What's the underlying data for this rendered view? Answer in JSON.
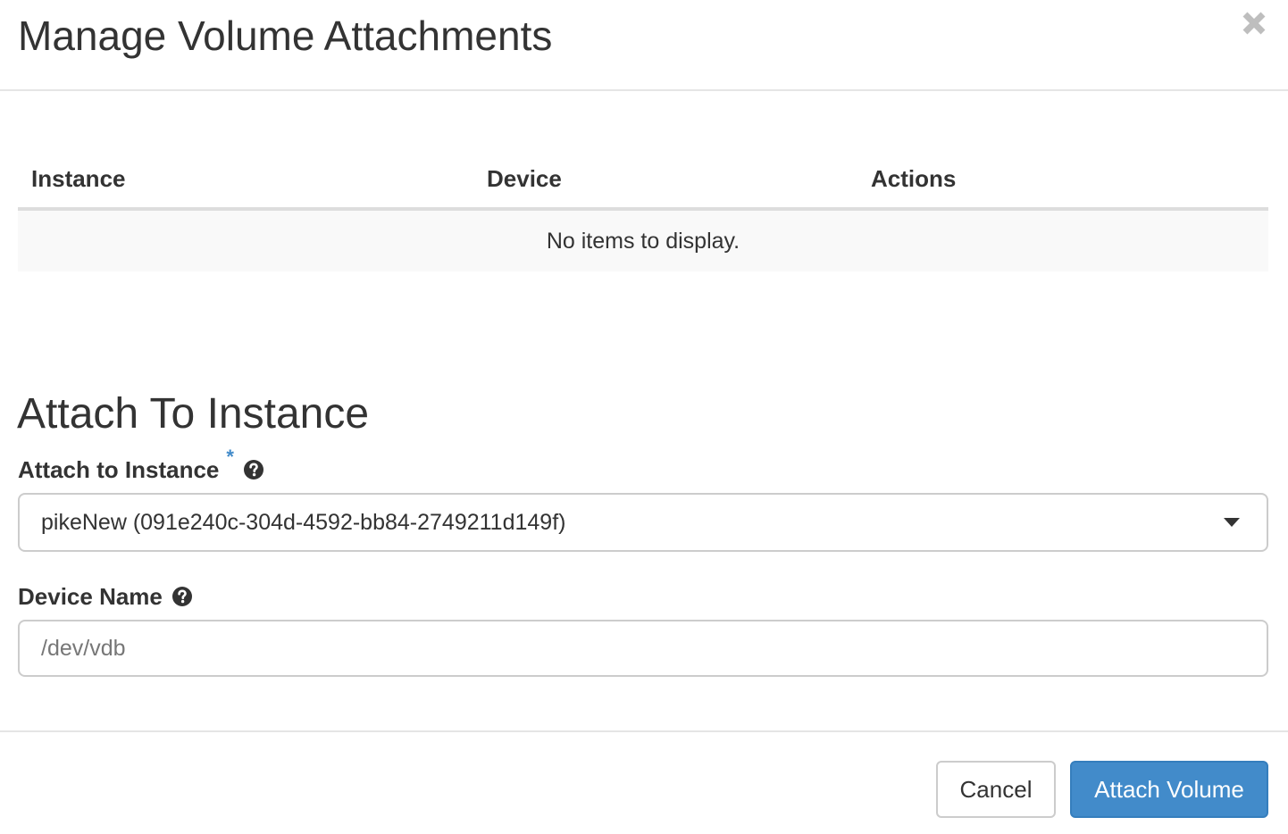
{
  "dialog": {
    "title": "Manage Volume Attachments",
    "close_icon": "close-icon"
  },
  "attachments_table": {
    "columns": [
      "Instance",
      "Device",
      "Actions"
    ],
    "rows": [],
    "empty_message": "No items to display."
  },
  "attach_section": {
    "title": "Attach To Instance",
    "instance_field": {
      "label": "Attach to Instance",
      "required_marker": "*",
      "help_icon": "question-circle-icon",
      "selected_value": "pikeNew (091e240c-304d-4592-bb84-2749211d149f)"
    },
    "device_field": {
      "label": "Device Name",
      "help_icon": "question-circle-icon",
      "placeholder": "/dev/vdb",
      "value": ""
    }
  },
  "footer": {
    "cancel_label": "Cancel",
    "submit_label": "Attach Volume"
  },
  "colors": {
    "primary": "#428bca",
    "required": "#428bca",
    "border": "#cccccc",
    "empty_row_bg": "#f9f9f9"
  }
}
